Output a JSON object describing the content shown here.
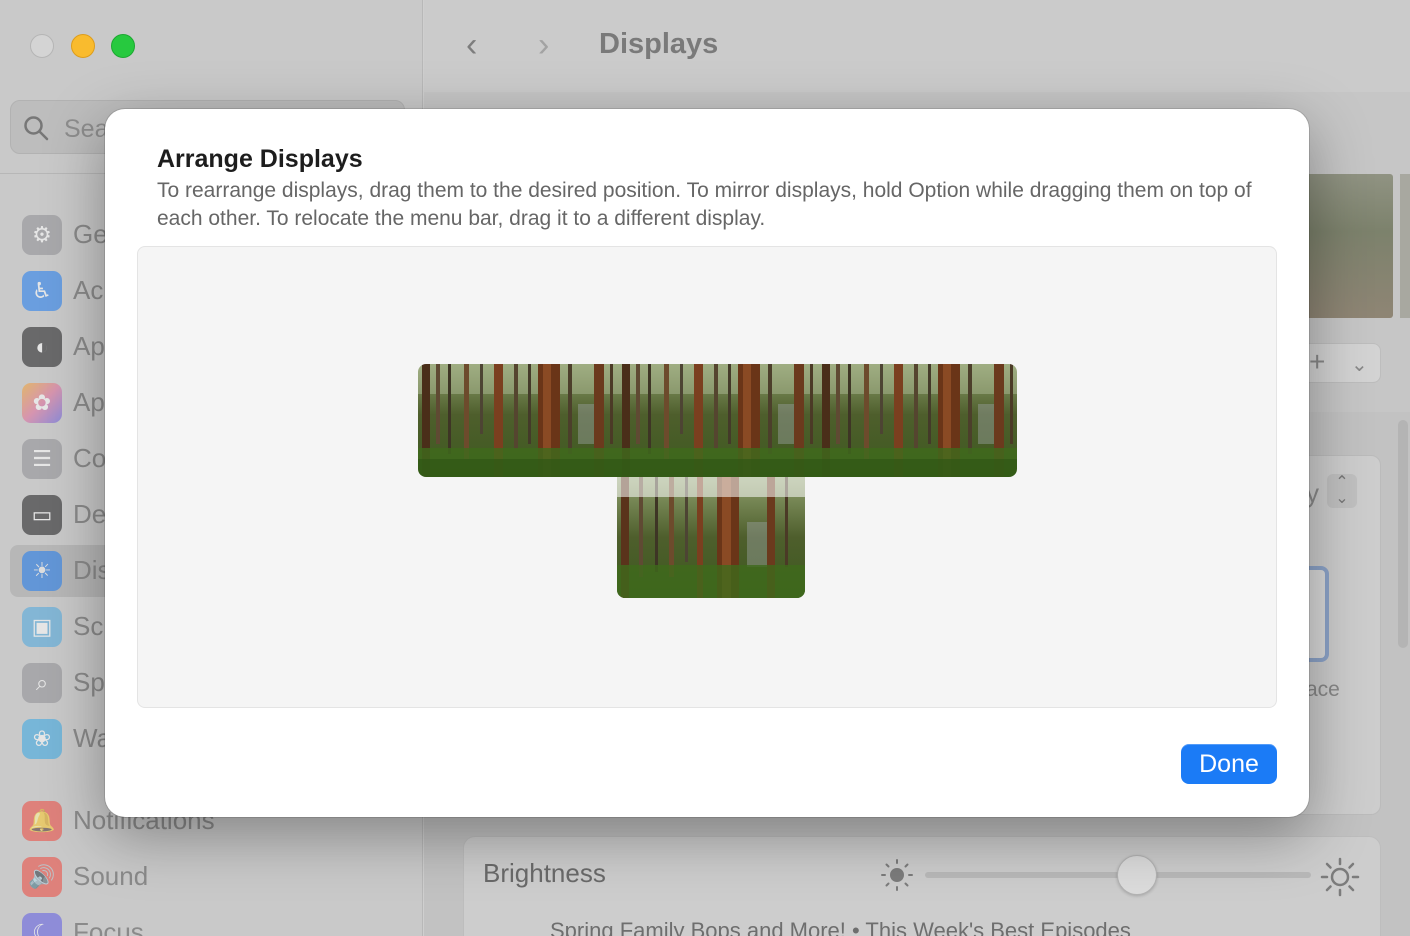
{
  "window": {
    "title": "Displays",
    "search_placeholder": "Sea",
    "back_glyph": "‹",
    "forward_glyph": "›"
  },
  "sidebar": {
    "items": [
      {
        "label": "Ge",
        "icon": "gear-icon",
        "color": "#8e8e93"
      },
      {
        "label": "Ac",
        "icon": "accessibility-icon",
        "color": "#1e7cf2"
      },
      {
        "label": "Ap",
        "icon": "appearance-icon",
        "color": "#1c1c1e"
      },
      {
        "label": "Ap",
        "icon": "apple-intelligence-icon",
        "color": "#e26b9a"
      },
      {
        "label": "Co",
        "icon": "control-center-icon",
        "color": "#8e8e93"
      },
      {
        "label": "De",
        "icon": "desktop-dock-icon",
        "color": "#1c1c1e"
      },
      {
        "label": "Dis",
        "icon": "displays-icon",
        "color": "#1e7cf2"
      },
      {
        "label": "Sc",
        "icon": "screen-saver-icon",
        "color": "#4aa8e0"
      },
      {
        "label": "Sp",
        "icon": "spotlight-icon",
        "color": "#8e8e93"
      },
      {
        "label": "Wa",
        "icon": "wallpaper-icon",
        "color": "#35a7e6"
      },
      {
        "label": "Notifications",
        "icon": "notifications-icon",
        "color": "#f0473d"
      },
      {
        "label": "Sound",
        "icon": "sound-icon",
        "color": "#f0473d"
      },
      {
        "label": "Focus",
        "icon": "focus-icon",
        "color": "#5e5ce6"
      }
    ]
  },
  "content": {
    "brightness_label": "Brightness",
    "partial_label_y": "y",
    "partial_label_ace": "ace",
    "bottom_ghost": "Spring Family Bops and More! • This Week's Best Episodes",
    "brightness_level": 0.55
  },
  "sheet": {
    "title": "Arrange Displays",
    "description": "To rearrange displays, drag them to the desired position. To mirror displays, hold Option while dragging them on top of each other. To relocate the menu bar, drag it to a different display.",
    "done_label": "Done"
  },
  "colors": {
    "accent": "#1b7bf6",
    "close": "#d4d4d4",
    "minimize": "#f9bb2e",
    "maximize": "#27c93f"
  }
}
